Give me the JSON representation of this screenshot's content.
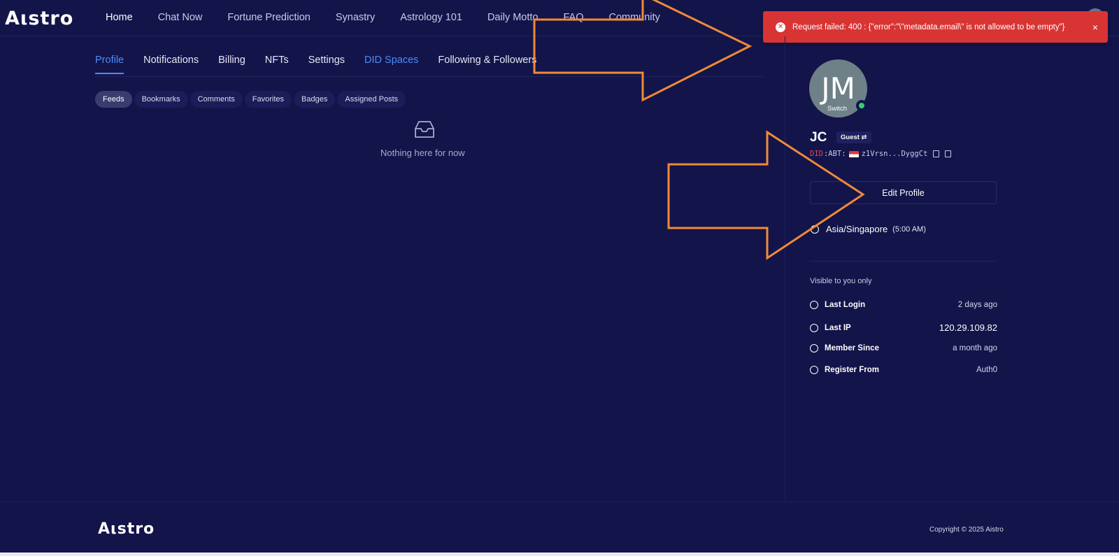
{
  "header": {
    "logo": "Aιstro",
    "nav": [
      "Home",
      "Chat Now",
      "Fortune Prediction",
      "Synastry",
      "Astrology 101",
      "Daily Motto",
      "FAQ",
      "Community"
    ]
  },
  "toast": {
    "message": "Request failed: 400 : {\"error\":\"\\\"metadata.email\\\" is not allowed to be empty\"}",
    "close": "×",
    "icon": "error-circle-icon"
  },
  "tabs": [
    "Profile",
    "Notifications",
    "Billing",
    "NFTs",
    "Settings",
    "DID Spaces",
    "Following & Followers"
  ],
  "subtabs": [
    "Feeds",
    "Bookmarks",
    "Comments",
    "Favorites",
    "Badges",
    "Assigned Posts"
  ],
  "empty": {
    "text": "Nothing here for now",
    "icon": "inbox-icon"
  },
  "profile": {
    "initials": "JM",
    "switch": "Switch",
    "name": "JC",
    "role": "Guest ⇄",
    "did_prefix": "DID",
    "did_chain": ":ABT:",
    "did_value": "z1Vrsn...DyggCt",
    "edit_label": "Edit Profile",
    "timezone": "Asia/Singapore",
    "local_time": "(5:00 AM)",
    "visible_note": "Visible to you only",
    "info": [
      {
        "label": "Last Login",
        "value": "2 days ago"
      },
      {
        "label": "Last IP",
        "value": "120.29.109.82"
      },
      {
        "label": "Member Since",
        "value": "a month ago"
      },
      {
        "label": "Register From",
        "value": "Auth0"
      }
    ]
  },
  "footer": {
    "logo": "Aιstro",
    "copyright": "Copyright © 2025 Aistro"
  },
  "colors": {
    "background": "#13144a",
    "accent": "#4d8cf5",
    "error": "#d93434",
    "annotation": "#f08a36"
  }
}
